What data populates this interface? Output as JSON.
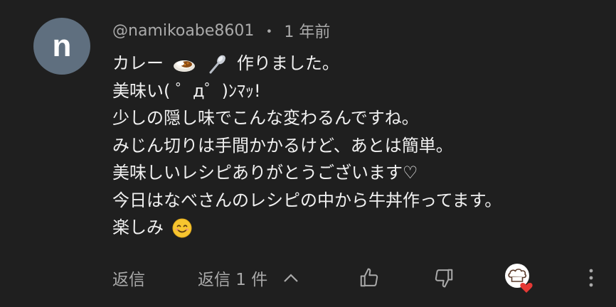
{
  "comment": {
    "avatar_letter": "n",
    "author": "@namikoabe8601",
    "separator": "・",
    "time": "1 年前",
    "lines": [
      "カレー",
      "作りました。",
      "美味い( ゜д゜)ﾝﾏｯ!",
      "少しの隠し味でこんな変わるんですね。",
      "みじん切りは手間かかるけど、あとは簡単。",
      "美味しいレシピありがとうございます♡",
      "今日はなべさんのレシピの中から牛丼作ってます。",
      "楽しみ"
    ]
  },
  "actions": {
    "reply_label": "返信",
    "replies_toggle_label": "返信 1 件"
  },
  "icons": {
    "curry": "curry-icon",
    "spoon": "spoon-icon",
    "smile": "smiling-face-icon",
    "chevron": "chevron-up-icon",
    "like": "thumbs-up-icon",
    "dislike": "thumbs-down-icon",
    "creator_heart": "creator-heart-icon",
    "more": "more-vert-icon"
  },
  "colors": {
    "background": "#1f1f1f",
    "text_primary": "#f1f1f1",
    "text_secondary": "#aaaaaa",
    "avatar_bg": "#5f6f7f",
    "heart": "#e53935"
  }
}
